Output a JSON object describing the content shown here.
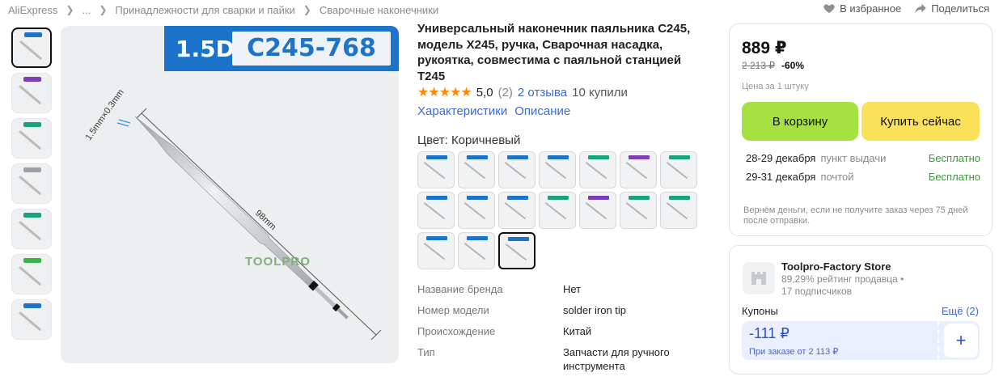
{
  "breadcrumb": {
    "items": [
      "AliExpress",
      "...",
      "Принадлежности для сварки и пайки",
      "Сварочные наконечники"
    ]
  },
  "top_actions": {
    "favorite": "В избранное",
    "share": "Поделиться"
  },
  "gallery": {
    "thumb_tag_colors": [
      "#1b74c9",
      "#7d3fb5",
      "#17a47a",
      "#9aa0a6",
      "#17a47a",
      "#38b44a",
      "#1b74c9"
    ],
    "banner_left": "1.5D",
    "banner_right": "C245-768",
    "dim_tip": "1.5mm×0.3mm",
    "dim_length": "98mm",
    "watermark": "TOOLPRO"
  },
  "product": {
    "title": "Универсальный наконечник паяльника C245, модель X245, ручка, Сварочная насадка, рукоятка, совместима с паяльной станцией T245",
    "stars": "★★★★★",
    "rating": "5,0",
    "reviews_count": "(2)",
    "reviews_link": "2 отзыва",
    "bought": "10 купили",
    "tabs": [
      "Характеристики",
      "Описание"
    ],
    "color_label": "Цвет: Коричневый",
    "swatch_tag_colors": [
      "#1b74c9",
      "#1b74c9",
      "#1b74c9",
      "#1b74c9",
      "#17a47a",
      "#7d3fb5",
      "#17a47a",
      "#1b74c9",
      "#1b74c9",
      "#1b74c9",
      "#17a47a",
      "#7d3fb5",
      "#17a47a",
      "#17a47a",
      "#1b74c9",
      "#1b74c9",
      "#1b74c9"
    ],
    "selected_swatch": 16
  },
  "specs": [
    {
      "key": "Название бренда",
      "value": "Нет"
    },
    {
      "key": "Номер модели",
      "value": "solder iron tip"
    },
    {
      "key": "Происхождение",
      "value": "Китай"
    },
    {
      "key": "Тип",
      "value": "Запчасти для ручного инструмента"
    }
  ],
  "buy_box": {
    "price": "889 ₽",
    "old_price": "2 213 ₽",
    "discount": "-60%",
    "unit_note": "Цена за 1 штуку",
    "cart_button": "В корзину",
    "buy_button": "Купить сейчас",
    "shipping": [
      {
        "date": "28-29 декабря",
        "method": "пункт выдачи",
        "cost": "Бесплатно"
      },
      {
        "date": "29-31 декабря",
        "method": "почтой",
        "cost": "Бесплатно"
      }
    ],
    "refund_note": "Вернём деньги, если не получите заказ через 75 дней после отправки."
  },
  "store": {
    "name": "Toolpro-Factory Store",
    "rating_text": "89,29% рейтинг продавца",
    "bullet": "•",
    "subscribers": "17 подписчиков",
    "coupons_label": "Купоны",
    "coupons_more": "Ещё (2)",
    "coupon_amount": "-111 ₽",
    "coupon_condition": "При заказе от 2 113 ₽",
    "coupon_add": "+"
  },
  "colors": {
    "accent_blue": "#3a6bd4",
    "cart_green": "#a6e142",
    "buy_yellow": "#fbe15a",
    "star_orange": "#ff8a00",
    "free_green": "#3a9b3a"
  }
}
